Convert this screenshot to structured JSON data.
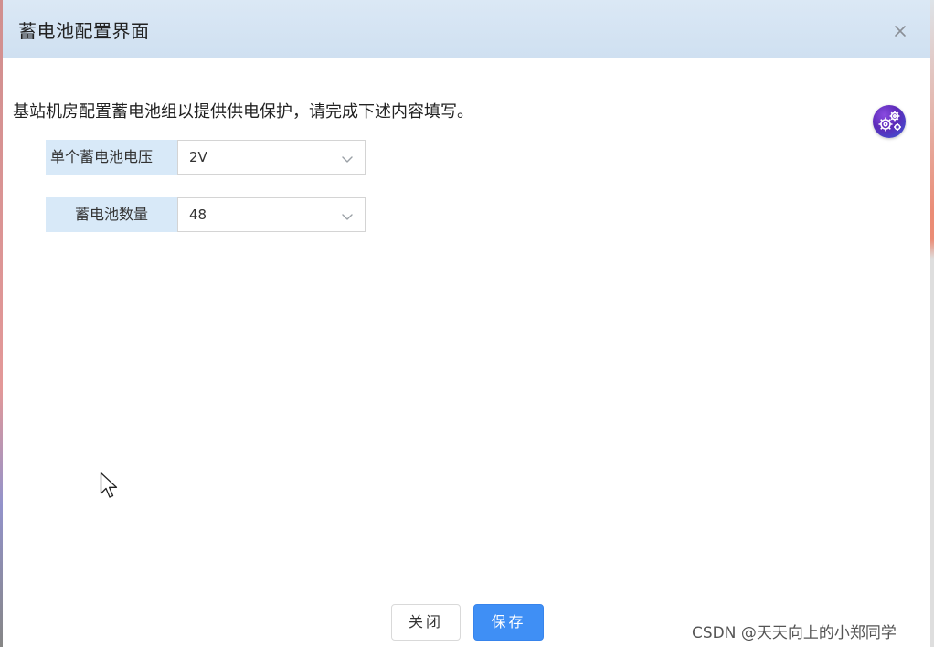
{
  "dialog": {
    "title": "蓄电池配置界面",
    "close_icon": "close-icon"
  },
  "instructions": "基站机房配置蓄电池组以提供供电保护，请完成下述内容填写。",
  "assistant": {
    "icon": "gear-cluster-icon",
    "colors": [
      "#8a4be0",
      "#3b5bd6"
    ]
  },
  "form": {
    "voltage": {
      "label": "单个蓄电池电压",
      "value": "2V",
      "icon": "chevron-down-icon"
    },
    "count": {
      "label": "蓄电池数量",
      "value": "48",
      "icon": "chevron-down-icon"
    }
  },
  "footer": {
    "close_label": "关闭",
    "save_label": "保存",
    "save_color": "#3f8ff5"
  },
  "watermark": "CSDN @天天向上的小郑同学"
}
